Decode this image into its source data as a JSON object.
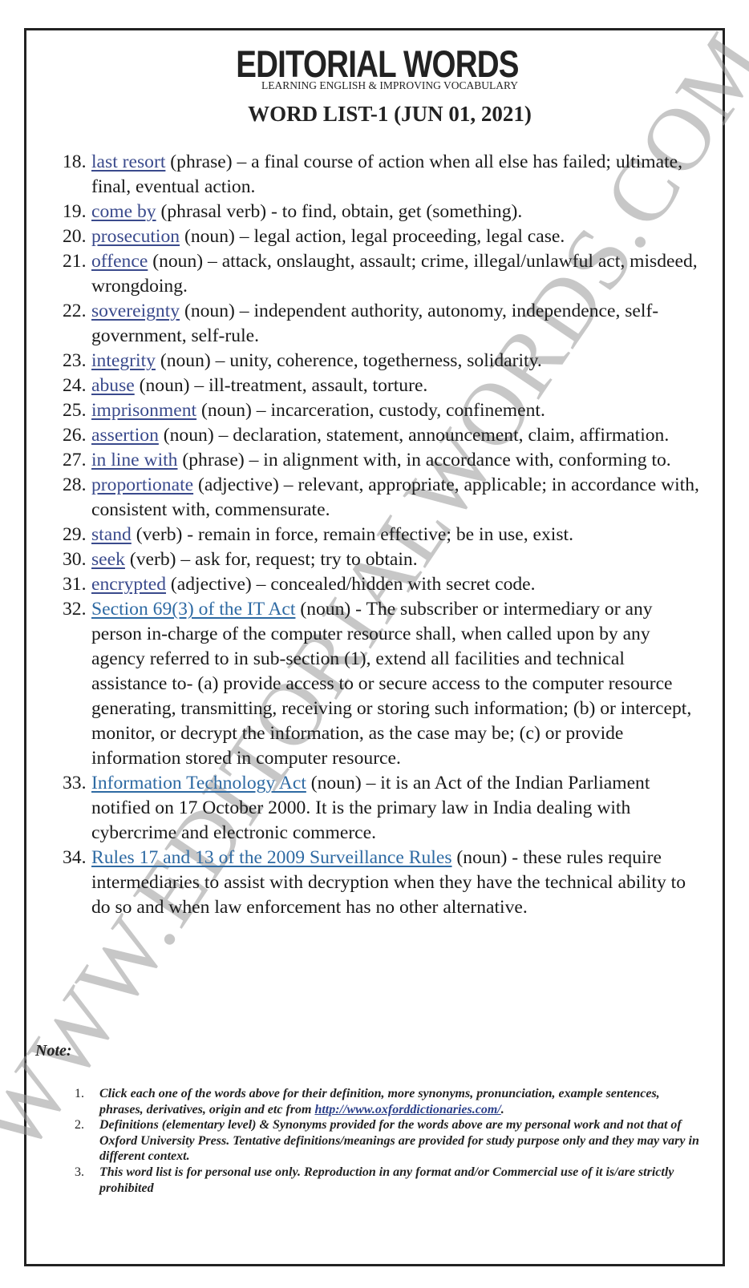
{
  "header": {
    "brand": "EDITORIAL WORDS",
    "tagline": "LEARNING ENGLISH & IMPROVING VOCABULARY",
    "list_title": "WORD LIST-1 (JUN 01, 2021)"
  },
  "watermark": "WWW.EDITORIALWORDS.COM",
  "colors": {
    "link_primary": "#3a4a8c",
    "link_secondary": "#2e6aa3",
    "border": "#222222",
    "watermark": "#9a9a9a"
  },
  "entries": [
    {
      "num": "18.",
      "word": "last resort",
      "style": "w1",
      "rest": " (phrase) – a final course of action when all else has failed; ultimate, final, eventual action."
    },
    {
      "num": "19.",
      "word": "come by",
      "style": "w1",
      "rest": " (phrasal verb) - to find, obtain, get (something)."
    },
    {
      "num": "20.",
      "word": "prosecution",
      "style": "w1",
      "rest": " (noun) – legal action, legal proceeding, legal case."
    },
    {
      "num": "21.",
      "word": "offence",
      "style": "w1",
      "rest": " (noun) – attack, onslaught, assault; crime, illegal/unlawful act, misdeed, wrongdoing."
    },
    {
      "num": "22.",
      "word": "sovereignty",
      "style": "w1",
      "rest": " (noun) – independent authority, autonomy, independence, self-government, self-rule."
    },
    {
      "num": "23.",
      "word": "integrity",
      "style": "w1",
      "rest": " (noun) – unity, coherence, togetherness, solidarity."
    },
    {
      "num": "24.",
      "word": "abuse",
      "style": "w1",
      "rest": " (noun) – ill-treatment, assault, torture."
    },
    {
      "num": "25.",
      "word": "imprisonment",
      "style": "w1",
      "rest": " (noun) – incarceration, custody, confinement."
    },
    {
      "num": "26.",
      "word": "assertion",
      "style": "w1",
      "rest": " (noun) – declaration, statement, announcement, claim, affirmation."
    },
    {
      "num": "27.",
      "word": "in line with",
      "style": "w1",
      "rest": " (phrase) – in alignment with, in accordance with, conforming to."
    },
    {
      "num": "28.",
      "word": "proportionate",
      "style": "w1",
      "rest": " (adjective) – relevant, appropriate, applicable; in accordance with, consistent with, commensurate."
    },
    {
      "num": "29.",
      "word": "stand",
      "style": "w1",
      "rest": " (verb) - remain in force, remain effective; be in use, exist."
    },
    {
      "num": "30.",
      "word": "seek",
      "style": "w1",
      "rest": " (verb) – ask for, request; try to obtain."
    },
    {
      "num": "31.",
      "word": "encrypted",
      "style": "w1",
      "rest": " (adjective) – concealed/hidden with secret code."
    },
    {
      "num": "32.",
      "word": "Section 69(3) of the IT Act",
      "style": "w2",
      "rest": " (noun) - The subscriber or intermediary or any person in-charge of the computer resource shall, when called upon by any agency referred to in sub-section (1), extend all facilities and technical assistance to- (a) provide access to or secure access to the computer resource generating, transmitting, receiving or storing such information; (b) or intercept, monitor, or decrypt the information, as the case may be; (c) or provide information stored in computer resource."
    },
    {
      "num": "33.",
      "word": "Information Technology Act",
      "style": "w2",
      "rest": " (noun) – it is an Act of the Indian Parliament notified on 17 October 2000. It is the primary law in India dealing with cybercrime and electronic commerce."
    },
    {
      "num": "34.",
      "word": "Rules 17 and 13 of the 2009 Surveillance Rules",
      "style": "w2",
      "rest": " (noun) - these rules require intermediaries to assist with decryption when they have the technical ability to do so and when law enforcement has no other alternative."
    }
  ],
  "notes": {
    "label": "Note:",
    "items": [
      {
        "num": "1.",
        "text": "Click each one of the words above for their definition, more synonyms, pronunciation, example sentences, phrases, derivatives, origin and etc from ",
        "link": "http://www.oxforddictionaries.com/",
        "after": "."
      },
      {
        "num": "2.",
        "text": "Definitions (elementary level) & Synonyms provided for the words above are my personal work and not that of Oxford University Press. Tentative definitions/meanings are provided for study purpose only and they may vary in different context.",
        "link": "",
        "after": ""
      },
      {
        "num": "3.",
        "text": "This word list is for personal use only. Reproduction in any format and/or Commercial use of it is/are strictly prohibited",
        "link": "",
        "after": ""
      }
    ]
  }
}
